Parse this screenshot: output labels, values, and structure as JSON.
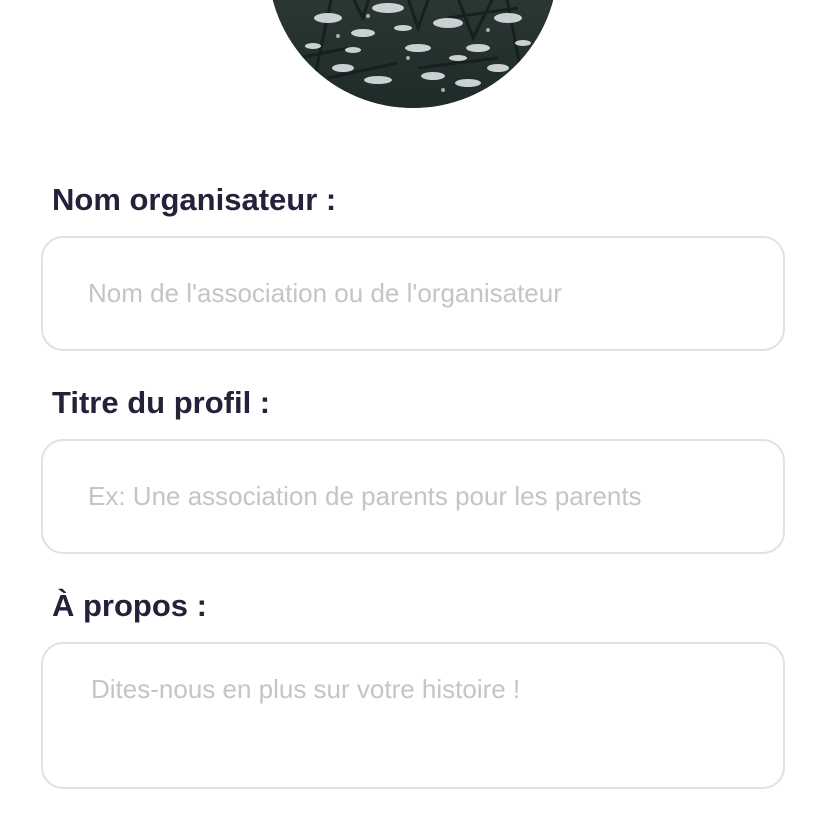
{
  "profile": {
    "avatar_description": "snow-covered-pine-branches-photo"
  },
  "form": {
    "organizer_name": {
      "label": "Nom organisateur :",
      "placeholder": "Nom de l'association ou de l'organisateur",
      "value": ""
    },
    "profile_title": {
      "label": "Titre du profil :",
      "placeholder": "Ex: Une association de parents pour les parents",
      "value": ""
    },
    "about": {
      "label": "À propos :",
      "placeholder": "Dites-nous en plus sur votre histoire !",
      "value": ""
    }
  },
  "colors": {
    "label_text": "#24223a",
    "placeholder_text": "#c4c4c9",
    "input_border": "#e1e1e5",
    "background": "#ffffff"
  }
}
